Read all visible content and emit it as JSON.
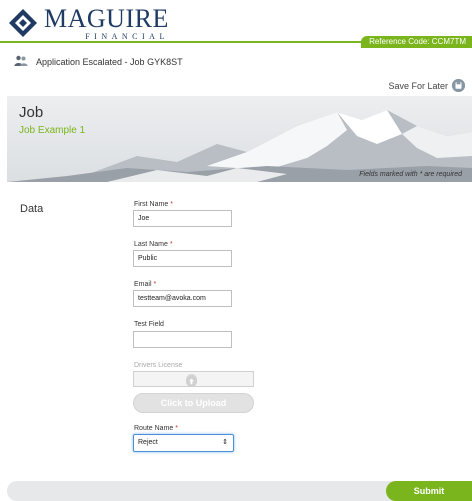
{
  "brand": {
    "name": "MAGUIRE",
    "sub": "FINANCIAL"
  },
  "header": {
    "reference": "Reference Code: CCM7TM"
  },
  "status": {
    "text": "Application Escalated - Job GYK8ST",
    "icon": "people-icon"
  },
  "toolbar": {
    "save_label": "Save For Later",
    "save_icon": "save-icon"
  },
  "banner": {
    "title": "Job",
    "subtitle": "Job Example 1",
    "note": "Fields marked with * are required"
  },
  "section": {
    "label": "Data"
  },
  "form": {
    "first_name": {
      "label": "First Name",
      "required": "*",
      "value": "Joe"
    },
    "last_name": {
      "label": "Last Name",
      "required": "*",
      "value": "Public"
    },
    "email": {
      "label": "Email",
      "required": "*",
      "value": "testteam@avoka.com"
    },
    "test_field": {
      "label": "Test Field",
      "value": ""
    },
    "drivers_license": {
      "label": "Drivers License",
      "upload_label": "Click to Upload"
    },
    "route_name": {
      "label": "Route Name",
      "required": "*",
      "value": "Reject"
    }
  },
  "footer": {
    "submit_label": "Submit"
  },
  "colors": {
    "brand": "#1f3a63",
    "accent": "#7ab51d",
    "required": "#c0392b"
  }
}
